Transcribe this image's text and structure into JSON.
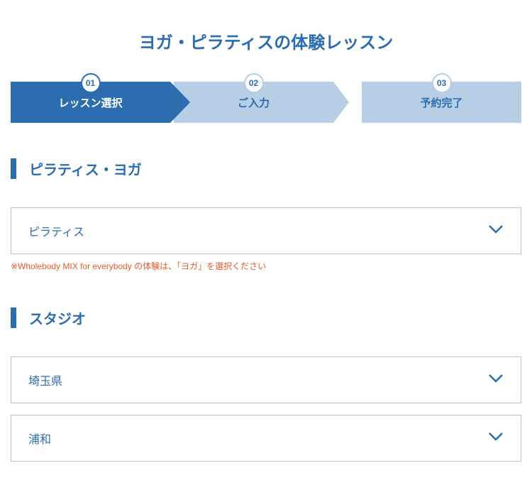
{
  "title": "ヨガ・ピラティスの体験レッスン",
  "steps": [
    {
      "number": "01",
      "label": "レッスン選択"
    },
    {
      "number": "02",
      "label": "ご入力"
    },
    {
      "number": "03",
      "label": "予約完了"
    }
  ],
  "section1": {
    "heading": "ピラティス・ヨガ",
    "selected": "ピラティス",
    "note": "※Wholebody MIX for everybody の体験は、「ヨガ」を選択ください"
  },
  "section2": {
    "heading": "スタジオ",
    "prefecture": "埼玉県",
    "studio": "浦和"
  }
}
